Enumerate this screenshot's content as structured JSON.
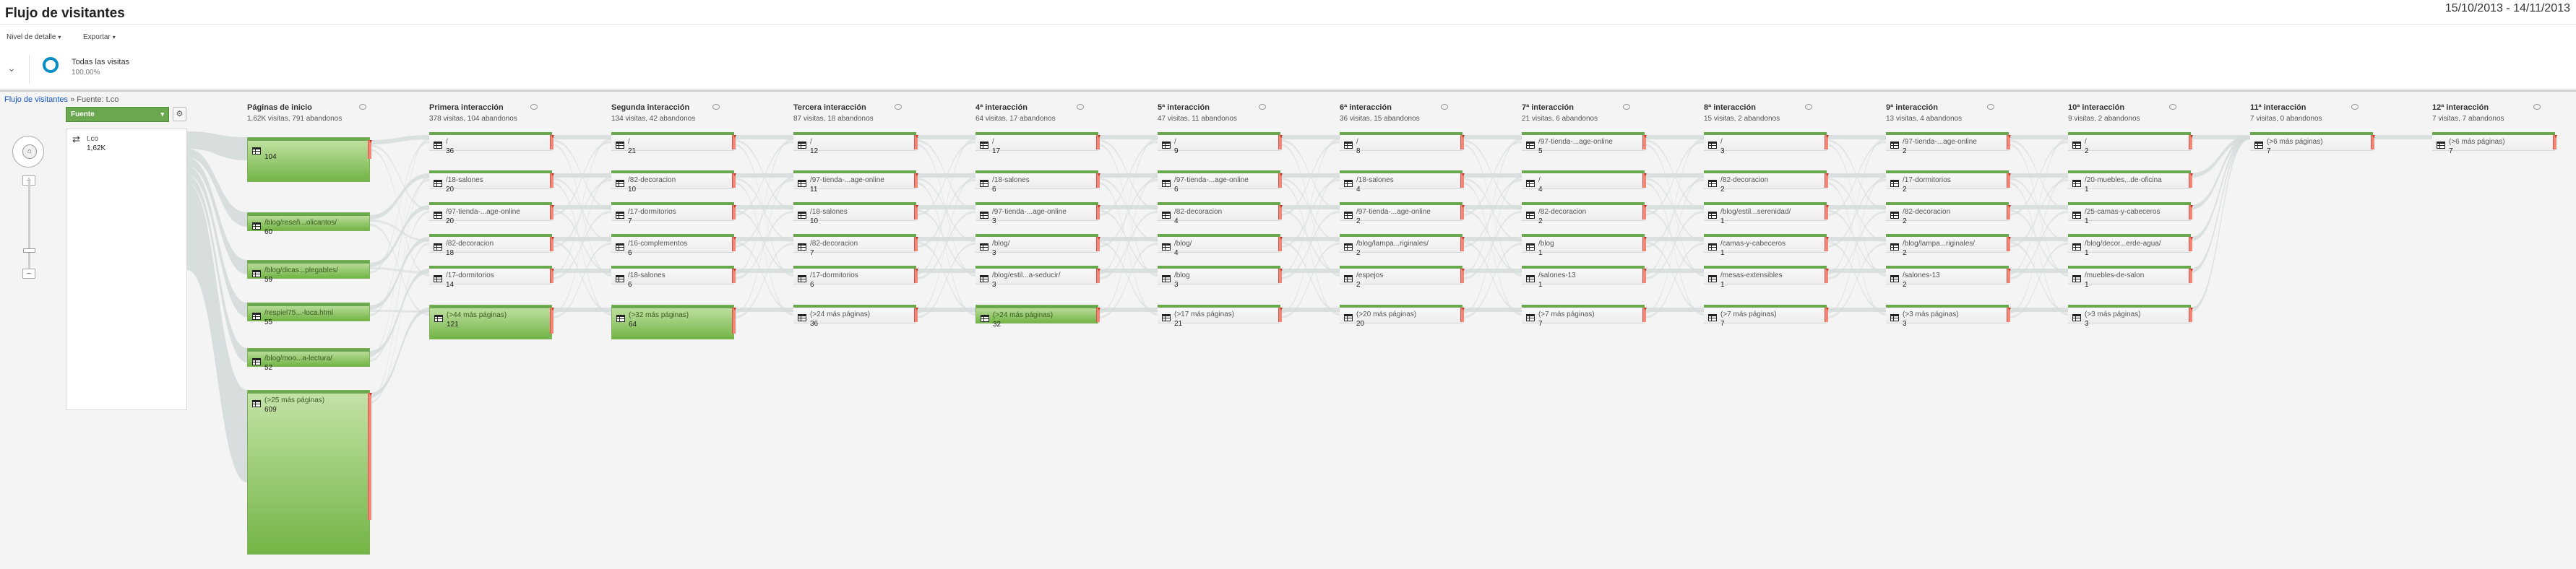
{
  "header": {
    "title": "Flujo de visitantes",
    "date_range": "15/10/2013 - 14/11/2013"
  },
  "toolbar": {
    "detail_label": "Nivel de detalle",
    "export_label": "Exportar"
  },
  "segment": {
    "name": "Todas las visitas",
    "percent": "100,00%"
  },
  "breadcrumb": {
    "root": "Flujo de visitantes",
    "separator": "»",
    "current": "Fuente: t.co"
  },
  "dimension_select": {
    "label": "Fuente"
  },
  "source": {
    "name": "t.co",
    "count": "1,62K"
  },
  "colors": {
    "accent": "#058dc7",
    "node_green": "#6aa84f",
    "drop": "#f28775",
    "flow": "#d5dbdb"
  },
  "columns": [
    {
      "title": "Páginas de inicio",
      "stats": "1,62K visitas, 791 abandonos",
      "nodes": [
        {
          "label": "",
          "value": "104",
          "active": true
        },
        {
          "label": "/blog/reseñ...olicantos/",
          "value": "60",
          "active": true
        },
        {
          "label": "/blog/dicas...plegables/",
          "value": "59",
          "active": true
        },
        {
          "label": "/respiel75...-loca.html",
          "value": "55",
          "active": true
        },
        {
          "label": "/blog/moo...a-lectura/",
          "value": "52",
          "active": true
        },
        {
          "label": "(>25 más páginas)",
          "value": "609",
          "active": true
        }
      ]
    },
    {
      "title": "Primera interacción",
      "stats": "378 visitas, 104 abandonos",
      "nodes": [
        {
          "label": "/",
          "value": "36"
        },
        {
          "label": "/18-salones",
          "value": "20"
        },
        {
          "label": "/97-tienda-...age-online",
          "value": "20"
        },
        {
          "label": "/82-decoracion",
          "value": "18"
        },
        {
          "label": "/17-dormitorios",
          "value": "14"
        },
        {
          "label": "(>44 más páginas)",
          "value": "121",
          "active": true
        }
      ]
    },
    {
      "title": "Segunda interacción",
      "stats": "134 visitas, 42 abandonos",
      "nodes": [
        {
          "label": "/",
          "value": "21"
        },
        {
          "label": "/82-decoracion",
          "value": "10"
        },
        {
          "label": "/17-dormitorios",
          "value": "7"
        },
        {
          "label": "/16-complementos",
          "value": "6"
        },
        {
          "label": "/18-salones",
          "value": "6"
        },
        {
          "label": "(>32 más páginas)",
          "value": "64",
          "active": true
        }
      ]
    },
    {
      "title": "Tercera interacción",
      "stats": "87 visitas, 18 abandonos",
      "nodes": [
        {
          "label": "/",
          "value": "12"
        },
        {
          "label": "/97-tienda-...age-online",
          "value": "11"
        },
        {
          "label": "/18-salones",
          "value": "10"
        },
        {
          "label": "/82-decoracion",
          "value": "7"
        },
        {
          "label": "/17-dormitorios",
          "value": "6"
        },
        {
          "label": "(>24 más páginas)",
          "value": "36"
        }
      ]
    },
    {
      "title": "4ª interacción",
      "stats": "64 visitas, 17 abandonos",
      "nodes": [
        {
          "label": "/",
          "value": "17"
        },
        {
          "label": "/18-salones",
          "value": "6"
        },
        {
          "label": "/97-tienda-...age-online",
          "value": "3"
        },
        {
          "label": "/blog/",
          "value": "3"
        },
        {
          "label": "/blog/estil...a-seducir/",
          "value": "3"
        },
        {
          "label": "(>24 más páginas)",
          "value": "32",
          "active": true
        }
      ]
    },
    {
      "title": "5ª interacción",
      "stats": "47 visitas, 11 abandonos",
      "nodes": [
        {
          "label": "/",
          "value": "9"
        },
        {
          "label": "/97-tienda-...age-online",
          "value": "6"
        },
        {
          "label": "/82-decoracion",
          "value": "4"
        },
        {
          "label": "/blog/",
          "value": "4"
        },
        {
          "label": "/blog",
          "value": "3"
        },
        {
          "label": "(>17 más páginas)",
          "value": "21"
        }
      ]
    },
    {
      "title": "6ª interacción",
      "stats": "36 visitas, 15 abandonos",
      "nodes": [
        {
          "label": "/",
          "value": "8"
        },
        {
          "label": "/18-salones",
          "value": "4"
        },
        {
          "label": "/97-tienda-...age-online",
          "value": "2"
        },
        {
          "label": "/blog/lampa...riginales/",
          "value": "2"
        },
        {
          "label": "/espejos",
          "value": "2"
        },
        {
          "label": "(>20 más páginas)",
          "value": "20"
        }
      ]
    },
    {
      "title": "7ª interacción",
      "stats": "21 visitas, 6 abandonos",
      "nodes": [
        {
          "label": "/97-tienda-...age-online",
          "value": "5"
        },
        {
          "label": "/",
          "value": "4"
        },
        {
          "label": "/82-decoracion",
          "value": "2"
        },
        {
          "label": "/blog",
          "value": "1"
        },
        {
          "label": "/salones-13",
          "value": "1"
        },
        {
          "label": "(>7 más páginas)",
          "value": "7"
        }
      ]
    },
    {
      "title": "8ª interacción",
      "stats": "15 visitas, 2 abandonos",
      "nodes": [
        {
          "label": "/",
          "value": "3"
        },
        {
          "label": "/82-decoracion",
          "value": "2"
        },
        {
          "label": "/blog/estil...serenidad/",
          "value": "1"
        },
        {
          "label": "/camas-y-cabeceros",
          "value": "1"
        },
        {
          "label": "/mesas-extensibles",
          "value": "1"
        },
        {
          "label": "(>7 más páginas)",
          "value": "7"
        }
      ]
    },
    {
      "title": "9ª interacción",
      "stats": "13 visitas, 4 abandonos",
      "nodes": [
        {
          "label": "/97-tienda-...age-online",
          "value": "2"
        },
        {
          "label": "/17-dormitorios",
          "value": "2"
        },
        {
          "label": "/82-decoracion",
          "value": "2"
        },
        {
          "label": "/blog/lampa...riginales/",
          "value": "2"
        },
        {
          "label": "/salones-13",
          "value": "2"
        },
        {
          "label": "(>3 más páginas)",
          "value": "3"
        }
      ]
    },
    {
      "title": "10ª interacción",
      "stats": "9 visitas, 2 abandonos",
      "nodes": [
        {
          "label": "/",
          "value": "2"
        },
        {
          "label": "/20-muebles...de-oficina",
          "value": "1"
        },
        {
          "label": "/25-camas-y-cabeceros",
          "value": "1"
        },
        {
          "label": "/blog/decor...erde-agua/",
          "value": "1"
        },
        {
          "label": "/muebles-de-salon",
          "value": "1"
        },
        {
          "label": "(>3 más páginas)",
          "value": "3"
        }
      ]
    },
    {
      "title": "11ª interacción",
      "stats": "7 visitas, 0 abandonos",
      "nodes": [
        {
          "label": "(>6 más páginas)",
          "value": "7"
        }
      ]
    },
    {
      "title": "12ª interacción",
      "stats": "7 visitas, 7 abandonos",
      "nodes": [
        {
          "label": "(>6 más páginas)",
          "value": "7"
        }
      ]
    }
  ]
}
